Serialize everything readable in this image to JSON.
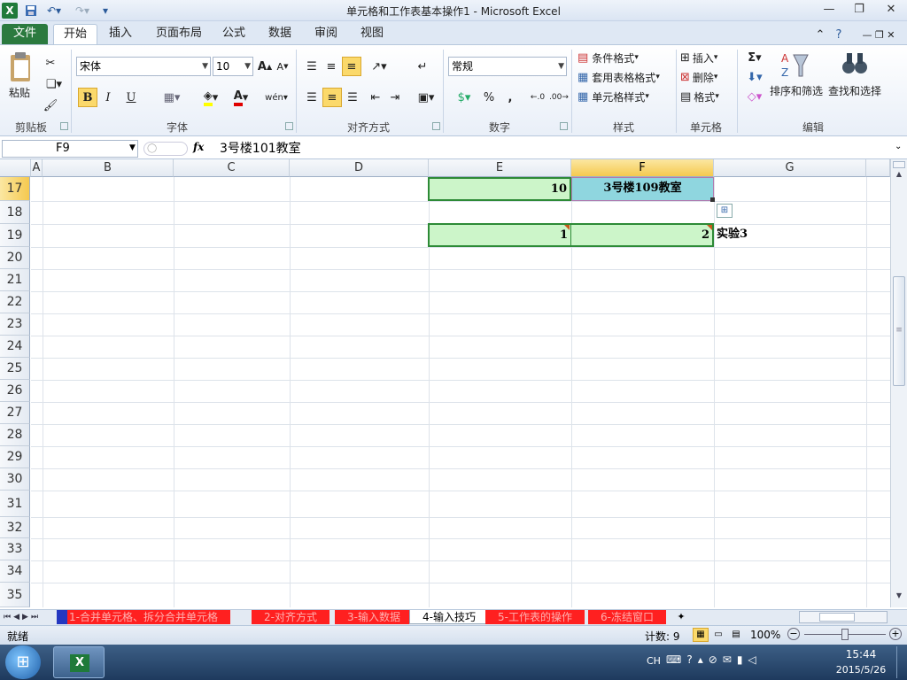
{
  "window": {
    "title": "单元格和工作表基本操作1 - Microsoft Excel"
  },
  "ribbon_tabs": [
    "文件",
    "开始",
    "插入",
    "页面布局",
    "公式",
    "数据",
    "审阅",
    "视图"
  ],
  "clipboard": {
    "paste": "粘贴",
    "group": "剪贴板"
  },
  "font": {
    "name": "宋体",
    "size": "10",
    "group": "字体",
    "bold": "B",
    "italic": "I",
    "underline": "U",
    "font_color_glyph": "A",
    "phonetic": "wén"
  },
  "alignment": {
    "group": "对齐方式"
  },
  "number": {
    "format": "常规",
    "group": "数字",
    "percent": "%",
    "comma": ","
  },
  "styles": {
    "conditional": "条件格式",
    "table": "套用表格格式",
    "cell": "单元格样式",
    "group": "样式"
  },
  "cells": {
    "insert": "插入",
    "delete": "删除",
    "format": "格式",
    "group": "单元格"
  },
  "editing": {
    "sum": "Σ",
    "sort": "排序和筛选",
    "find": "查找和选择",
    "group": "编辑"
  },
  "formula_bar": {
    "name_box": "F9",
    "fx": "fx",
    "content": "3号楼101教室"
  },
  "columns": [
    "A",
    "B",
    "C",
    "D",
    "E",
    "F",
    "G"
  ],
  "rows": [
    "17",
    "18",
    "19",
    "20",
    "21",
    "22",
    "23",
    "24",
    "25",
    "26",
    "27",
    "28",
    "29",
    "30",
    "31",
    "32",
    "33",
    "34",
    "35"
  ],
  "cell_values": {
    "E17": "10",
    "F17": "3号楼109教室",
    "E19": "1",
    "F19": "2",
    "G19": "实验3"
  },
  "sheets": [
    "1-合并单元格、拆分合并单元格",
    "2-对齐方式",
    "3-输入数据",
    "4-输入技巧",
    "5-工作表的操作",
    "6-冻结窗口"
  ],
  "status": {
    "ready": "就绪",
    "count": "计数: 9",
    "zoom": "100%"
  },
  "taskbar": {
    "lang": "CH",
    "time": "15:44",
    "date": "2015/5/26"
  },
  "colors": {
    "green_fill": "#ccf5c9",
    "cyan_fill": "#8fd6df",
    "accent": "#2b7a3f"
  }
}
